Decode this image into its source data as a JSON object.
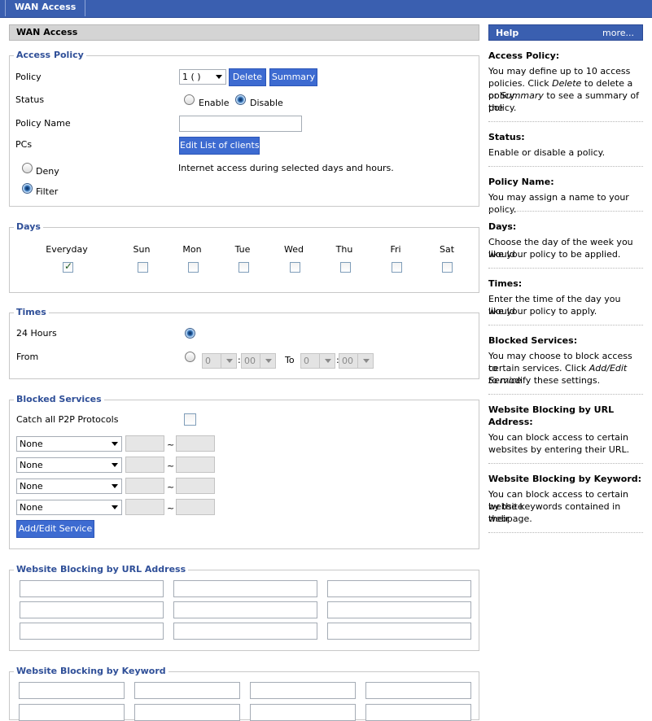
{
  "top_tab": "WAN Access",
  "section_title": "WAN Access",
  "access_policy": {
    "legend": "Access Policy",
    "policy_label": "Policy",
    "policy_value": "1 ( )",
    "delete": "Delete",
    "summary": "Summary",
    "status_label": "Status",
    "enable": "Enable",
    "disable": "Disable",
    "policy_name_label": "Policy Name",
    "policy_name_value": "",
    "pcs_label": "PCs",
    "edit_clients": "Edit List of clients",
    "deny": "Deny",
    "filter": "Filter",
    "note": "Internet access during selected days and hours."
  },
  "days": {
    "legend": "Days",
    "items": [
      {
        "label": "Everyday",
        "checked": true
      },
      {
        "label": "Sun",
        "checked": false
      },
      {
        "label": "Mon",
        "checked": false
      },
      {
        "label": "Tue",
        "checked": false
      },
      {
        "label": "Wed",
        "checked": false
      },
      {
        "label": "Thu",
        "checked": false
      },
      {
        "label": "Fri",
        "checked": false
      },
      {
        "label": "Sat",
        "checked": false
      }
    ]
  },
  "times": {
    "legend": "Times",
    "hours_label": "24 Hours",
    "from_label": "From",
    "from_hour": "0",
    "from_min": "00",
    "to_label": "To",
    "to_hour": "0",
    "to_min": "00",
    "colon": ":"
  },
  "blocked": {
    "legend": "Blocked Services",
    "p2p_label": "Catch all P2P Protocols",
    "rows": [
      "None",
      "None",
      "None",
      "None"
    ],
    "tilde": "~",
    "add_edit": "Add/Edit Service"
  },
  "url_block": {
    "legend": "Website Blocking by URL Address"
  },
  "keyword_block": {
    "legend": "Website Blocking by Keyword"
  },
  "help": {
    "title": "Help",
    "more": "more...",
    "p1_title": "Access Policy:",
    "p1_a": "You may define up to 10 access",
    "p1_b1": "policies. Click ",
    "p1_b_em": "Delete",
    "p1_b2": " to delete a policy",
    "p1_c1": "or ",
    "p1_c_em": "Summary",
    "p1_c2": " to see a summary of the",
    "p1_d": "policy.",
    "p2_title": "Status:",
    "p2_a": "Enable or disable a policy.",
    "p3_title": "Policy Name:",
    "p3_a": "You may assign a name to your policy.",
    "p4_title": "Days:",
    "p4_a": "Choose the day of the week you would",
    "p4_b": "like your policy to be applied.",
    "p5_title": "Times:",
    "p5_a": "Enter the time of the day you would",
    "p5_b": "like your policy to apply.",
    "p6_title": "Blocked Services:",
    "p6_a": "You may choose to block access to",
    "p6_b1": "certain services. Click ",
    "p6_b_em": "Add/Edit Service",
    "p6_c": "to modify these settings.",
    "p7_title_a": "Website Blocking by URL",
    "p7_title_b": "Address:",
    "p7_a": "You can block access to certain",
    "p7_b": "websites by entering their URL.",
    "p8_title": "Website Blocking by Keyword:",
    "p8_a": "You can block access to certain website",
    "p8_b": "by the keywords contained in their",
    "p8_c": "webpage."
  }
}
